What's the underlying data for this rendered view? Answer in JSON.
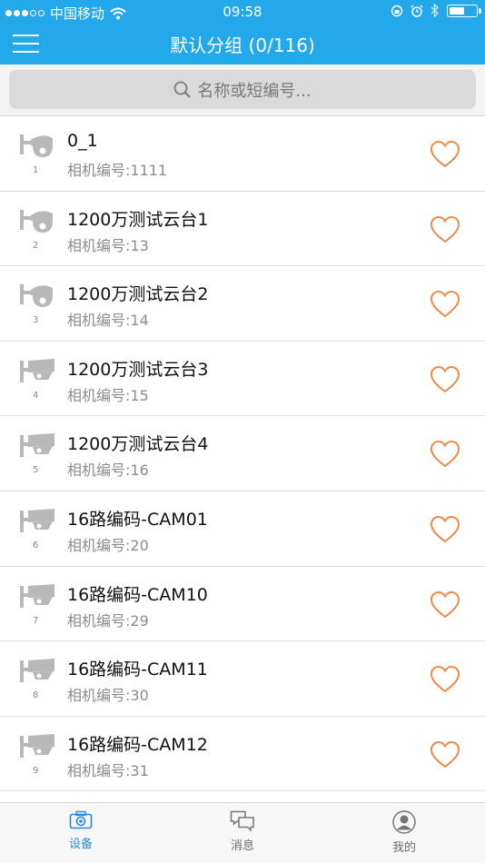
{
  "status_bar": {
    "carrier": "中国移动",
    "time": "09:58"
  },
  "nav": {
    "title": "默认分组 (0/116)"
  },
  "search": {
    "placeholder": "名称或短编号..."
  },
  "devices": [
    {
      "index": "1",
      "type": "dome",
      "name": "0_1",
      "subtitle": "相机编号:1111"
    },
    {
      "index": "2",
      "type": "dome",
      "name": "1200万测试云台1",
      "subtitle": "相机编号:13"
    },
    {
      "index": "3",
      "type": "dome",
      "name": "1200万测试云台2",
      "subtitle": "相机编号:14"
    },
    {
      "index": "4",
      "type": "bullet",
      "name": "1200万测试云台3",
      "subtitle": "相机编号:15"
    },
    {
      "index": "5",
      "type": "bullet",
      "name": "1200万测试云台4",
      "subtitle": "相机编号:16"
    },
    {
      "index": "6",
      "type": "bullet",
      "name": "16路编码-CAM01",
      "subtitle": "相机编号:20"
    },
    {
      "index": "7",
      "type": "bullet",
      "name": "16路编码-CAM10",
      "subtitle": "相机编号:29"
    },
    {
      "index": "8",
      "type": "bullet",
      "name": "16路编码-CAM11",
      "subtitle": "相机编号:30"
    },
    {
      "index": "9",
      "type": "bullet",
      "name": "16路编码-CAM12",
      "subtitle": "相机编号:31"
    }
  ],
  "tabs": [
    {
      "label": "设备",
      "icon": "camera-icon",
      "active": true
    },
    {
      "label": "消息",
      "icon": "chat-icon",
      "active": false
    },
    {
      "label": "我的",
      "icon": "user-icon",
      "active": false
    }
  ],
  "colors": {
    "header": "#23a8ec",
    "heart": "#f08a4b",
    "tab_active": "#2a8be0"
  }
}
